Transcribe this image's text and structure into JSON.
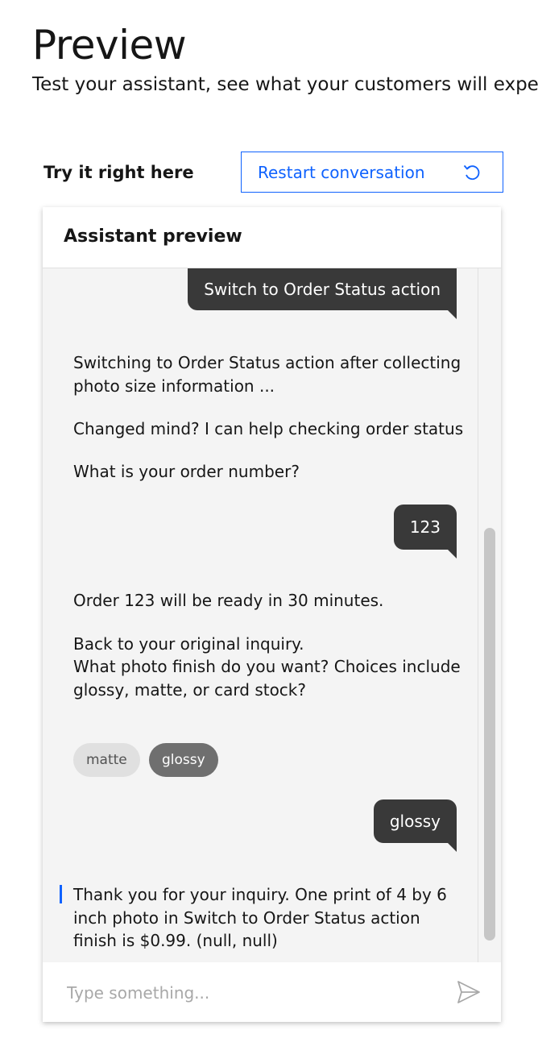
{
  "page": {
    "title": "Preview",
    "subtitle": "Test your assistant, see what your customers will experi"
  },
  "toolbar": {
    "try_label": "Try it right here",
    "restart_label": "Restart conversation"
  },
  "panel": {
    "title": "Assistant preview"
  },
  "messages": {
    "user_1": "Switch to Order Status action",
    "bot_1_line_1": "Switching to Order Status action after collecting photo size information ...",
    "bot_1_line_2": "Changed mind? I can help checking order status",
    "bot_1_line_3": "What is your order number?",
    "user_2": "123",
    "bot_2_line_1": "Order 123 will be ready in 30 minutes.",
    "bot_2_line_2": "Back to your original inquiry.",
    "bot_2_line_3": "What photo finish do you want? Choices include glossy, matte, or card stock?",
    "chip_1": "matte",
    "chip_2": "glossy",
    "user_3": "glossy",
    "bot_3": "Thank you for your inquiry. One print of 4 by 6 inch photo in Switch to Order Status action finish is $0.99. (null, null)"
  },
  "input": {
    "placeholder": "Type something..."
  },
  "icons": {
    "restart": "restart-icon",
    "send": "send-icon"
  },
  "colors": {
    "accent": "#0f62fe",
    "user_bubble": "#393939",
    "chip_selected": "#6f6f6f",
    "chip_default": "#e0e0e0",
    "panel_bg": "#f4f4f4"
  }
}
